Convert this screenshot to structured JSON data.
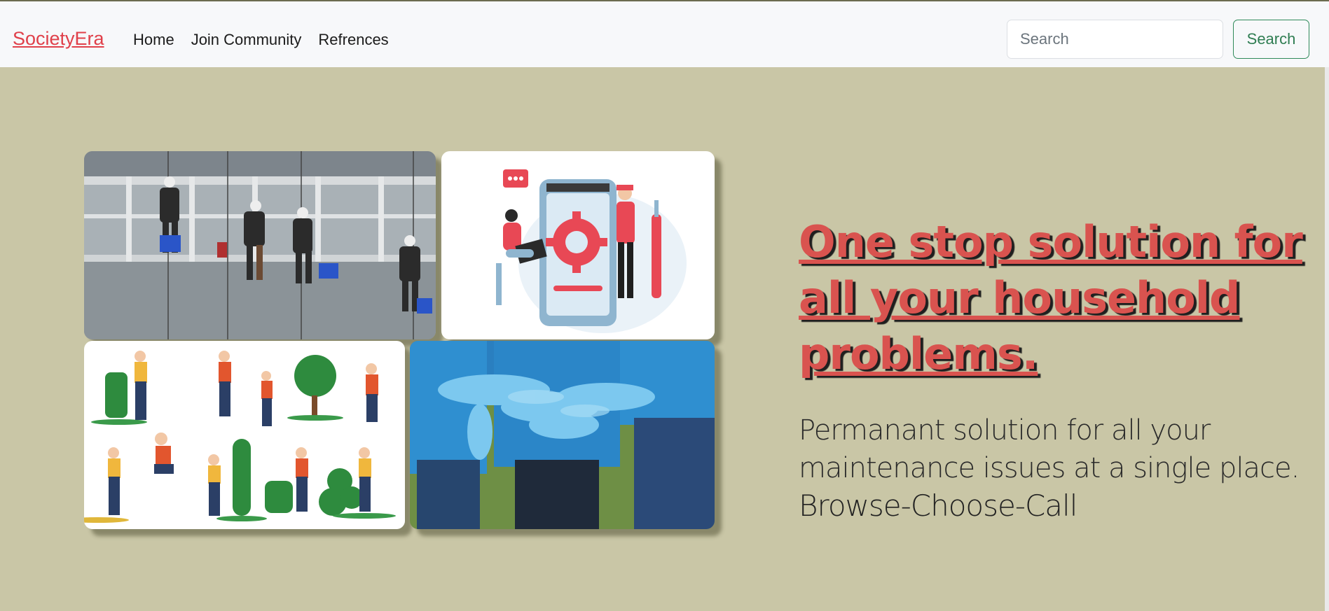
{
  "navbar": {
    "brand": "SocietyEra",
    "links": [
      {
        "label": "Home"
      },
      {
        "label": "Join Community"
      },
      {
        "label": "Refrences"
      }
    ],
    "search": {
      "placeholder": "Search",
      "value": ""
    },
    "search_button_label": "Search"
  },
  "hero": {
    "headline": "One stop solution for all your household problems.",
    "subline": "Permanant solution for all your maintenance issues at a single place.",
    "tagline": "Browse-Choose-Call"
  },
  "gallery": {
    "images": [
      {
        "name": "window-cleaners-image"
      },
      {
        "name": "repair-service-illustration"
      },
      {
        "name": "gardeners-illustration"
      },
      {
        "name": "team-hands-image"
      }
    ]
  },
  "colors": {
    "background": "#c9c6a6",
    "navbar": "#f7f8fa",
    "brand": "#e0404a",
    "headline": "#d9534f",
    "search_button": "#2f7d52"
  }
}
